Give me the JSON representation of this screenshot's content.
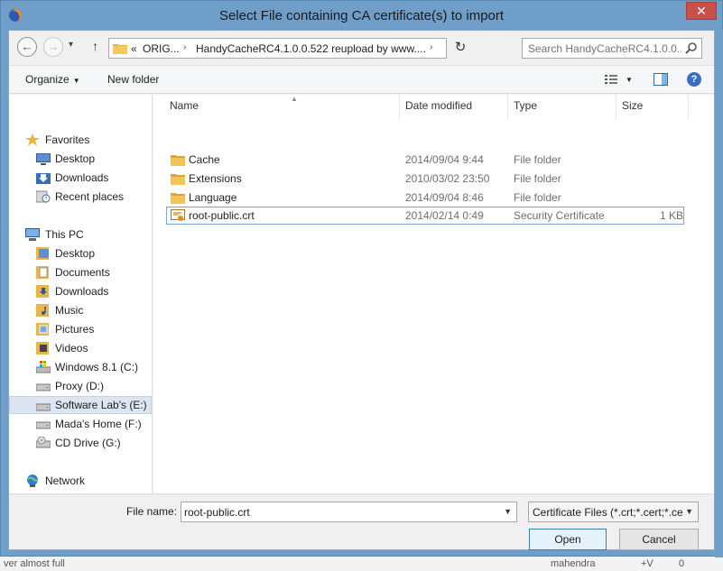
{
  "window": {
    "title": "Select File containing CA certificate(s) to import",
    "close_glyph": "✕"
  },
  "nav": {
    "back_glyph": "←",
    "forward_glyph": "→",
    "up_glyph": "↑",
    "refresh_glyph": "↻",
    "breadcrumb": [
      "«",
      "ORIG...",
      "HandyCacheRC4.1.0.0.522 reupload by www....",
      "›"
    ],
    "search_placeholder": "Search HandyCacheRC4.1.0.0...."
  },
  "toolbar": {
    "organize_label": "Organize",
    "new_folder_label": "New folder",
    "help_glyph": "?"
  },
  "sidebar": {
    "groups": [
      {
        "label": "Favorites",
        "icon": "star-icon",
        "items": [
          {
            "label": "Desktop",
            "icon": "desktop-icon"
          },
          {
            "label": "Downloads",
            "icon": "downloads-icon"
          },
          {
            "label": "Recent places",
            "icon": "recent-places-icon"
          }
        ]
      },
      {
        "label": "This PC",
        "icon": "computer-icon",
        "items": [
          {
            "label": "Desktop",
            "icon": "desktop-folder-icon"
          },
          {
            "label": "Documents",
            "icon": "documents-icon"
          },
          {
            "label": "Downloads",
            "icon": "downloads-folder-icon"
          },
          {
            "label": "Music",
            "icon": "music-icon"
          },
          {
            "label": "Pictures",
            "icon": "pictures-icon"
          },
          {
            "label": "Videos",
            "icon": "videos-icon"
          },
          {
            "label": "Windows 8.1 (C:)",
            "icon": "system-drive-icon"
          },
          {
            "label": "Proxy (D:)",
            "icon": "drive-icon"
          },
          {
            "label": "Software Lab's (E:)",
            "icon": "drive-icon",
            "selected": true
          },
          {
            "label": "Mada's Home (F:)",
            "icon": "drive-icon"
          },
          {
            "label": "CD Drive (G:)",
            "icon": "cd-drive-icon"
          }
        ]
      },
      {
        "label": "Network",
        "icon": "network-icon",
        "items": []
      }
    ]
  },
  "files": {
    "columns": [
      "Name",
      "Date modified",
      "Type",
      "Size"
    ],
    "rows": [
      {
        "name": "Cache",
        "date": "2014/09/04 9:44",
        "type": "File folder",
        "size": "",
        "icon": "folder-icon"
      },
      {
        "name": "Extensions",
        "date": "2010/03/02 23:50",
        "type": "File folder",
        "size": "",
        "icon": "folder-icon"
      },
      {
        "name": "Language",
        "date": "2014/09/04 8:46",
        "type": "File folder",
        "size": "",
        "icon": "folder-icon"
      },
      {
        "name": "root-public.crt",
        "date": "2014/02/14 0:49",
        "type": "Security Certificate",
        "size": "1 KB",
        "icon": "certificate-icon",
        "selected": true
      }
    ]
  },
  "bottom": {
    "filename_label": "File name:",
    "filename_value": "root-public.crt",
    "filetype_value": "Certificate Files (*.crt;*.cert;*.ce",
    "open_label": "Open",
    "cancel_label": "Cancel"
  },
  "background": {
    "left_text": "ver almost full",
    "user_text": "mahendra",
    "num_a": "+V",
    "num_b": "0"
  },
  "colors": {
    "titlebar": "#6f9fc9",
    "close": "#c7504b",
    "selection": "#dbe6f2",
    "folder": "#e8b54a"
  }
}
